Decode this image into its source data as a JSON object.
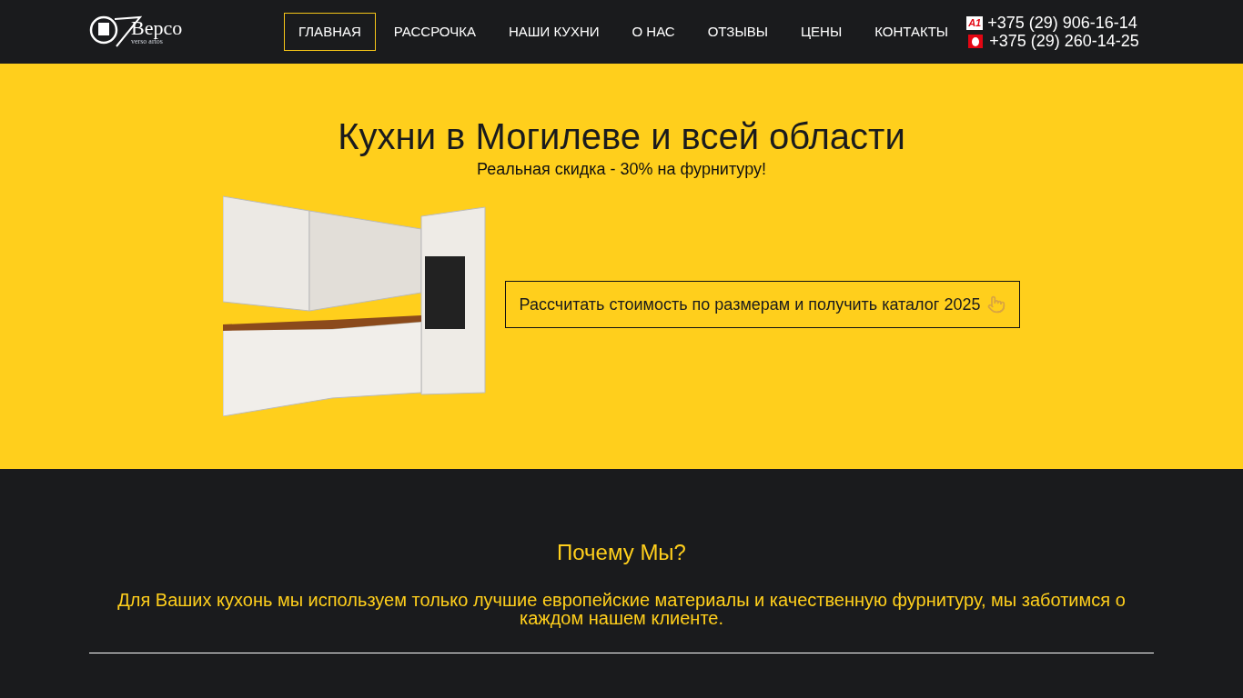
{
  "header": {
    "logo": {
      "name": "Версо",
      "tagline": "verso artos"
    },
    "nav": [
      {
        "label": "ГЛАВНАЯ",
        "selected": true
      },
      {
        "label": "РАССРОЧКА",
        "selected": false
      },
      {
        "label": "НАШИ КУХНИ",
        "selected": false
      },
      {
        "label": "О НАС",
        "selected": false
      },
      {
        "label": "ОТЗЫВЫ",
        "selected": false
      },
      {
        "label": "ЦЕНЫ",
        "selected": false
      },
      {
        "label": "КОНТАКТЫ",
        "selected": false
      }
    ],
    "phones": [
      {
        "operator_logo": "A1",
        "number": "+375 (29) 906-16-14"
      },
      {
        "number": "+375 (29) 260-14-25"
      }
    ]
  },
  "hero": {
    "title": "Кухни в Могилеве и всей области",
    "subtitle": "Реальная скидка - 30% на фурнитуру!",
    "cta": "Рассчитать стоимость по размерам и получить каталог 2025"
  },
  "why": {
    "title": "Почему Мы?",
    "text": "Для Ваших кухонь мы используем только лучшие европейские материалы и качественную фурнитуру, мы заботимся о каждом нашем клиенте."
  }
}
